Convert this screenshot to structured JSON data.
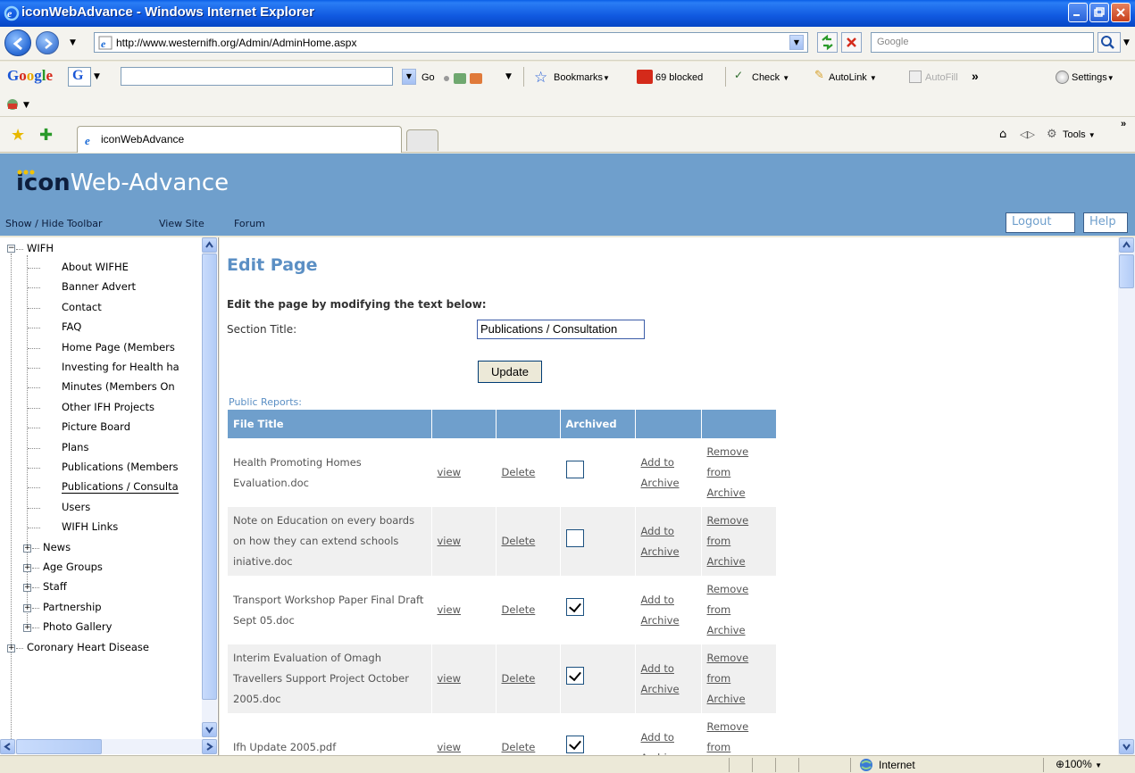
{
  "window": {
    "title": "iconWebAdvance - Windows Internet Explorer"
  },
  "address": {
    "url": "http://www.westernifh.org/Admin/AdminHome.aspx",
    "search_placeholder": "Google"
  },
  "google_toolbar": {
    "logo": "Google",
    "go_label": "Go",
    "bookmarks_label": "Bookmarks",
    "blocked_label": "69 blocked",
    "check_label": "Check",
    "autolink_label": "AutoLink",
    "autofill_label": "AutoFill",
    "more_label": "»",
    "settings_label": "Settings"
  },
  "tabs": {
    "active_label": "iconWebAdvance",
    "tools_label": "Tools"
  },
  "app": {
    "logo_bold": "icon",
    "logo_rest": "Web-Advance",
    "nav": {
      "toolbar": "Show / Hide Toolbar",
      "view_site": "View Site",
      "forum": "Forum",
      "logout": "Logout",
      "help": "Help"
    }
  },
  "tree": {
    "root": "WIFH",
    "children": [
      "About WIFHE",
      "Banner Advert",
      "Contact",
      "FAQ",
      "Home Page (Members",
      "Investing for Health ha",
      "Minutes (Members On",
      "Other IFH Projects",
      "Picture Board",
      "Plans",
      "Publications (Members",
      "Publications / Consulta",
      "Users",
      "WIFH Links"
    ],
    "groups": [
      "News",
      "Age Groups",
      "Staff",
      "Partnership",
      "Photo Gallery"
    ],
    "root2": "Coronary Heart Disease"
  },
  "page": {
    "heading": "Edit Page",
    "instructions": "Edit the page by modifying the text below:",
    "section_title_label": "Section Title:",
    "section_title_value": "Publications / Consultation",
    "update_button": "Update",
    "public_reports_label": "Public Reports:"
  },
  "files_table": {
    "headers": [
      "File Title",
      "",
      "",
      "Archived",
      "",
      ""
    ],
    "view_label": "view",
    "delete_label": "Delete",
    "add_label": "Add to Archive",
    "remove_label": "Remove from Archive",
    "rows": [
      {
        "title": "Health Promoting Homes Evaluation.doc",
        "archived": false
      },
      {
        "title": "Note on Education on every boards on how they can extend schools iniative.doc",
        "archived": false
      },
      {
        "title": "Transport Workshop Paper Final Draft Sept 05.doc",
        "archived": true
      },
      {
        "title": "Interim Evaluation of Omagh Travellers Support Project October 2005.doc",
        "archived": true
      },
      {
        "title": "Ifh Update 2005.pdf",
        "archived": true
      }
    ]
  },
  "status": {
    "zone": "Internet",
    "zoom": "100%"
  }
}
